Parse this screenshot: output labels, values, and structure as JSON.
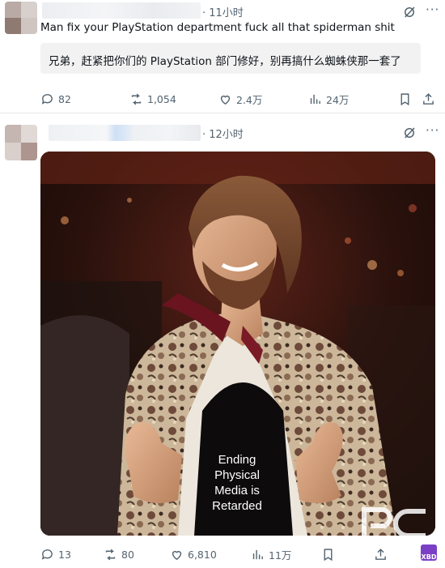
{
  "posts": [
    {
      "time": "· 11小时",
      "text": "Man fix your PlayStation department fuck all that spiderman shit",
      "translation": "兄弟，赶紧把你们的 PlayStation 部门修好，别再搞什么蜘蛛侠那一套了",
      "actions": {
        "replies": "82",
        "reposts": "1,054",
        "likes": "2.4万",
        "views": "24万"
      }
    },
    {
      "time": "· 12小时",
      "media": {
        "caption": "Ending Physical Media is Retarded"
      },
      "actions": {
        "replies": "13",
        "reposts": "80",
        "likes": "6,810",
        "views": "11万"
      }
    }
  ],
  "icons": [
    "reply-icon",
    "repost-icon",
    "like-icon",
    "views-icon",
    "bookmark-icon",
    "share-icon",
    "grok-icon",
    "more-icon"
  ],
  "watermark": {
    "text": "XBD",
    "color": "#7b3fc6"
  },
  "colors": {
    "text": "#0f1419",
    "muted": "#536471",
    "translate_bg": "#f2f2f2"
  }
}
